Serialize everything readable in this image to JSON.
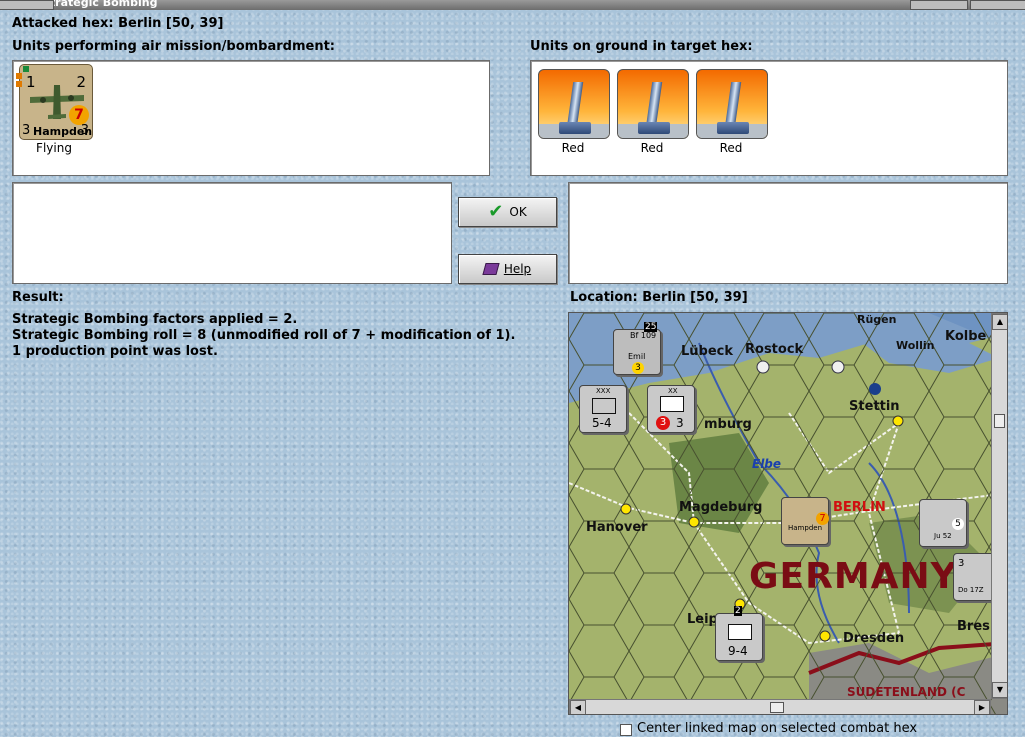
{
  "window": {
    "title": "Strategic Bombing"
  },
  "header": {
    "attacked_hex": "Attacked hex: Berlin  [50, 39]"
  },
  "air": {
    "label": "Units performing air mission/bombardment:",
    "units": [
      {
        "name": "Hampden",
        "left_value": "1",
        "right_value": "2",
        "attack": "3",
        "defense": "3",
        "badge": "7",
        "status": "Flying"
      }
    ]
  },
  "ground": {
    "label": "Units on ground in target hex:",
    "units": [
      {
        "status": "Red"
      },
      {
        "status": "Red"
      },
      {
        "status": "Red"
      }
    ]
  },
  "buttons": {
    "ok": "OK",
    "help": "Help"
  },
  "result": {
    "label": "Result:",
    "lines": [
      "Strategic Bombing factors applied = 2.",
      "Strategic Bombing roll = 8 (unmodified roll of 7 + modification of 1).",
      "1 production point was lost."
    ]
  },
  "location": {
    "label": "Location:  Berlin  [50, 39]"
  },
  "map": {
    "labels": {
      "lubeck": "Lübeck",
      "rostock": "Rostock",
      "rugen": "Rügen",
      "wollin": "Wollin",
      "kolberg": "Kolbe",
      "stettin": "Stettin",
      "hamburg": "mburg",
      "elbe": "Elbe",
      "magdeburg": "Magdeburg",
      "berlin": "BERLIN",
      "hanover": "Hanover",
      "germany": "GERMANY",
      "leipzig": "Leip",
      "dresden": "Dresden",
      "breslau": "Bres",
      "sudetenland": "SUDETENLAND (C"
    },
    "counters": {
      "corps1": {
        "strength": "5-4",
        "size": "XXX"
      },
      "armor": {
        "badge": "3",
        "value": "3",
        "size": "XX"
      },
      "inf2": {
        "strength": "9-4",
        "stack": "2"
      },
      "ju52": {
        "name": "Ju 52",
        "value": "5"
      },
      "do17": {
        "name": "Do 17Z",
        "value": "3"
      },
      "bf109": {
        "name": "Emil",
        "type": "Bf 109",
        "top": "25",
        "value": "3"
      },
      "hampden_map": {
        "name": "Hampden",
        "badge": "7"
      }
    }
  },
  "footer": {
    "center_map_label": "Center linked map on selected combat hex",
    "checked": false
  }
}
